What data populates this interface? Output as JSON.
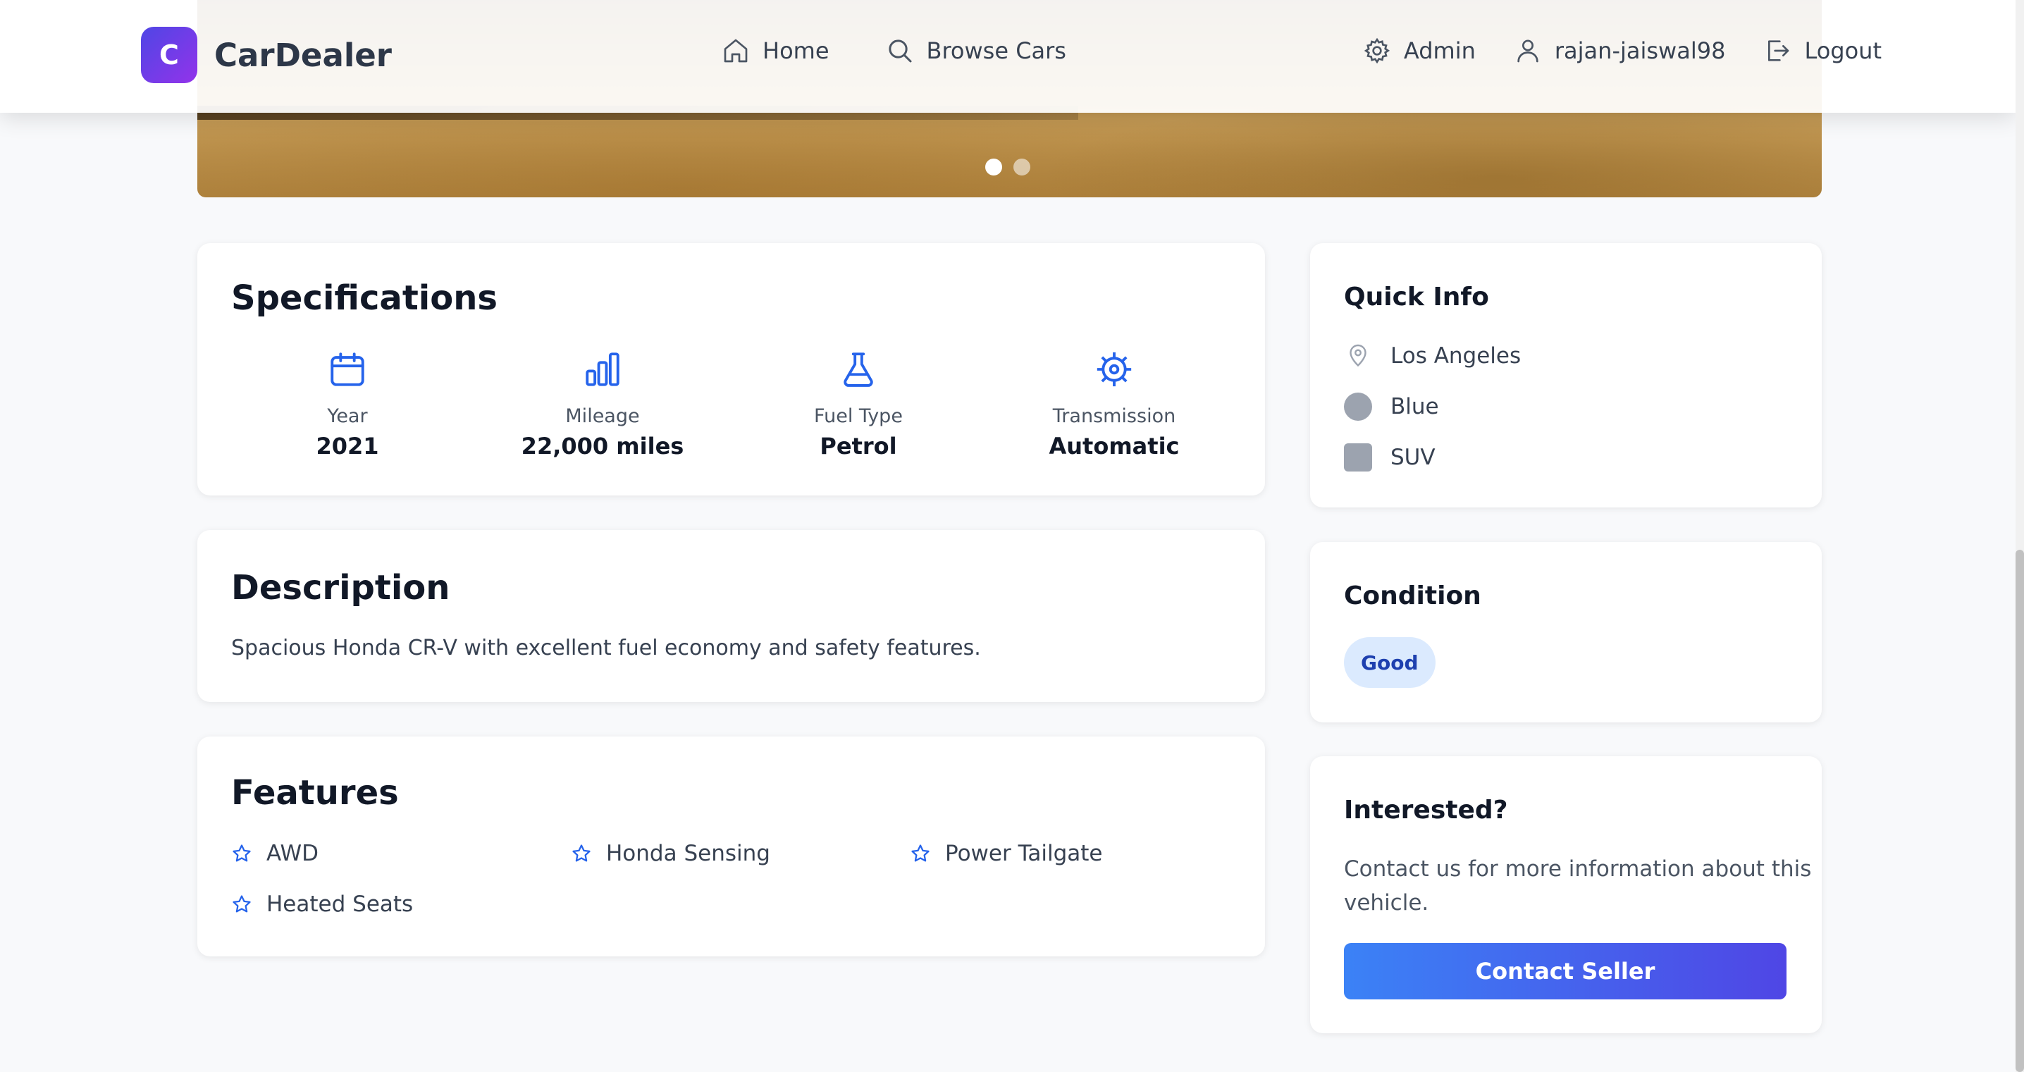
{
  "app": {
    "logo_letter": "C",
    "name": "CarDealer"
  },
  "nav": {
    "home": "Home",
    "browse": "Browse Cars",
    "admin": "Admin",
    "user": "rajan-jaiswal98",
    "logout": "Logout"
  },
  "carousel": {
    "slide_count": 2,
    "active_index": 0
  },
  "specs": {
    "title": "Specifications",
    "items": [
      {
        "label": "Year",
        "value": "2021",
        "icon": "calendar-icon"
      },
      {
        "label": "Mileage",
        "value": "22,000 miles",
        "icon": "bar-chart-icon"
      },
      {
        "label": "Fuel Type",
        "value": "Petrol",
        "icon": "flask-icon"
      },
      {
        "label": "Transmission",
        "value": "Automatic",
        "icon": "cog-icon"
      }
    ]
  },
  "description": {
    "title": "Description",
    "text": "Spacious Honda CR-V with excellent fuel economy and safety features."
  },
  "features": {
    "title": "Features",
    "items": [
      "AWD",
      "Honda Sensing",
      "Power Tailgate",
      "Heated Seats"
    ]
  },
  "quick_info": {
    "title": "Quick Info",
    "location": "Los Angeles",
    "color": "Blue",
    "body_type": "SUV"
  },
  "condition": {
    "title": "Condition",
    "value": "Good"
  },
  "interested": {
    "title": "Interested?",
    "text": "Contact us for more information about this vehicle.",
    "button": "Contact Seller"
  },
  "colors": {
    "accent": "#2563eb",
    "button_gradient_start": "#3b82f6",
    "button_gradient_end": "#4f46e5",
    "badge_bg": "#dbeafe",
    "badge_text": "#1e40af"
  }
}
